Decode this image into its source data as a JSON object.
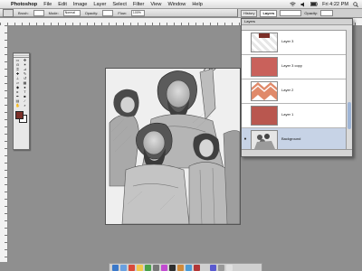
{
  "menubar": {
    "apple": "",
    "app": "Photoshop",
    "items": [
      "File",
      "Edit",
      "Image",
      "Layer",
      "Select",
      "Filter",
      "View",
      "Window",
      "Help"
    ],
    "clock": "Fri 4:22 PM"
  },
  "options": {
    "brush_label": "Brush:",
    "mode_label": "Mode:",
    "mode_value": "Normal",
    "opacity_label": "Opacity:",
    "flow_label": "Flow:",
    "flow_value": "100%"
  },
  "palette_well": {
    "tabs": [
      "History",
      "Layers"
    ],
    "opacity_label": "Opacity:"
  },
  "layers": {
    "title": "Layers",
    "items": [
      {
        "name": "Layer 3",
        "visible": false
      },
      {
        "name": "Layer 3 copy",
        "visible": false
      },
      {
        "name": "Layer 2",
        "visible": false
      },
      {
        "name": "Layer 1",
        "visible": false
      },
      {
        "name": "Background",
        "visible": true
      }
    ]
  },
  "colors": {
    "foreground": "#7b2f28",
    "background": "#ffffff",
    "layer_fill": "#c9615b"
  },
  "dock": {
    "colors": [
      "#3a78c9",
      "#6aa0e0",
      "#d94a3a",
      "#f2c84b",
      "#49a14a",
      "#777",
      "#c24bd1",
      "#2e2e2e",
      "#d08a3a",
      "#4c9bd6",
      "#b23636",
      "#cfcfcf",
      "#5a5ad0",
      "#999",
      "#e0e0e0"
    ]
  }
}
